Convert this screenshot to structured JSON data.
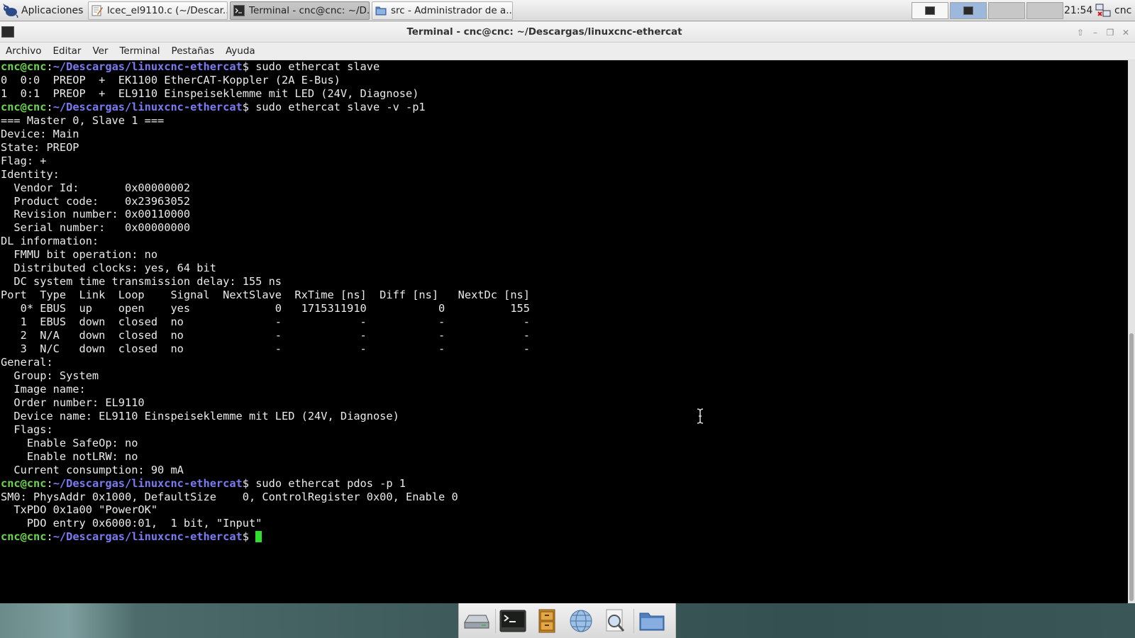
{
  "panel": {
    "apps_label": "Aplicaciones",
    "tasks": [
      {
        "label": "lcec_el9110.c (~/Descar...",
        "icon": "text-editor-icon"
      },
      {
        "label": "Terminal - cnc@cnc: ~/D...",
        "icon": "terminal-icon"
      },
      {
        "label": "src - Administrador de a...",
        "icon": "folder-icon"
      }
    ],
    "clock": "21:54",
    "user": "cnc"
  },
  "window": {
    "title": "Terminal - cnc@cnc: ~/Descargas/linuxcnc-ethercat",
    "menu": [
      "Archivo",
      "Editar",
      "Ver",
      "Terminal",
      "Pestañas",
      "Ayuda"
    ]
  },
  "terminal": {
    "prompt_user": "cnc@cnc",
    "prompt_sep": ":",
    "prompt_path": "~/Descargas/linuxcnc-ethercat",
    "prompt_end": "$",
    "lines": [
      {
        "type": "prompt",
        "cmd": " sudo ethercat slave"
      },
      {
        "type": "out",
        "text": "0  0:0  PREOP  +  EK1100 EtherCAT-Koppler (2A E-Bus)"
      },
      {
        "type": "out",
        "text": "1  0:1  PREOP  +  EL9110 Einspeiseklemme mit LED (24V, Diagnose)"
      },
      {
        "type": "prompt",
        "cmd": " sudo ethercat slave -v -p1"
      },
      {
        "type": "out",
        "text": "=== Master 0, Slave 1 ==="
      },
      {
        "type": "out",
        "text": "Device: Main"
      },
      {
        "type": "out",
        "text": "State: PREOP"
      },
      {
        "type": "out",
        "text": "Flag: +"
      },
      {
        "type": "out",
        "text": "Identity:"
      },
      {
        "type": "out",
        "text": "  Vendor Id:       0x00000002"
      },
      {
        "type": "out",
        "text": "  Product code:    0x23963052"
      },
      {
        "type": "out",
        "text": "  Revision number: 0x00110000"
      },
      {
        "type": "out",
        "text": "  Serial number:   0x00000000"
      },
      {
        "type": "out",
        "text": "DL information:"
      },
      {
        "type": "out",
        "text": "  FMMU bit operation: no"
      },
      {
        "type": "out",
        "text": "  Distributed clocks: yes, 64 bit"
      },
      {
        "type": "out",
        "text": "  DC system time transmission delay: 155 ns"
      },
      {
        "type": "out",
        "text": "Port  Type  Link  Loop    Signal  NextSlave  RxTime [ns]  Diff [ns]   NextDc [ns]"
      },
      {
        "type": "out",
        "text": "   0* EBUS  up    open    yes             0   1715311910           0          155"
      },
      {
        "type": "out",
        "text": "   1  EBUS  down  closed  no              -            -           -            -"
      },
      {
        "type": "out",
        "text": "   2  N/A   down  closed  no              -            -           -            -"
      },
      {
        "type": "out",
        "text": "   3  N/C   down  closed  no              -            -           -            -"
      },
      {
        "type": "out",
        "text": "General:"
      },
      {
        "type": "out",
        "text": "  Group: System"
      },
      {
        "type": "out",
        "text": "  Image name:"
      },
      {
        "type": "out",
        "text": "  Order number: EL9110"
      },
      {
        "type": "out",
        "text": "  Device name: EL9110 Einspeiseklemme mit LED (24V, Diagnose)"
      },
      {
        "type": "out",
        "text": "  Flags:"
      },
      {
        "type": "out",
        "text": "    Enable SafeOp: no"
      },
      {
        "type": "out",
        "text": "    Enable notLRW: no"
      },
      {
        "type": "out",
        "text": "  Current consumption: 90 mA"
      },
      {
        "type": "prompt",
        "cmd": " sudo ethercat pdos -p 1"
      },
      {
        "type": "out",
        "text": "SM0: PhysAddr 0x1000, DefaultSize    0, ControlRegister 0x00, Enable 0"
      },
      {
        "type": "out",
        "text": "  TxPDO 0x1a00 \"PowerOK\""
      },
      {
        "type": "out",
        "text": "    PDO entry 0x6000:01,  1 bit, \"Input\""
      },
      {
        "type": "prompt",
        "cmd": " ",
        "cursor": true
      }
    ]
  },
  "dock": [
    "home-drive-icon",
    "terminal-icon",
    "file-cabinet-icon",
    "web-browser-icon",
    "search-icon",
    "folder-icon"
  ],
  "colors": {
    "prompt_user": "#6cd64f",
    "prompt_path": "#7b7bf3",
    "cursor": "#2ee02e",
    "terminal_bg": "#000000",
    "terminal_fg": "#ebebeb"
  }
}
